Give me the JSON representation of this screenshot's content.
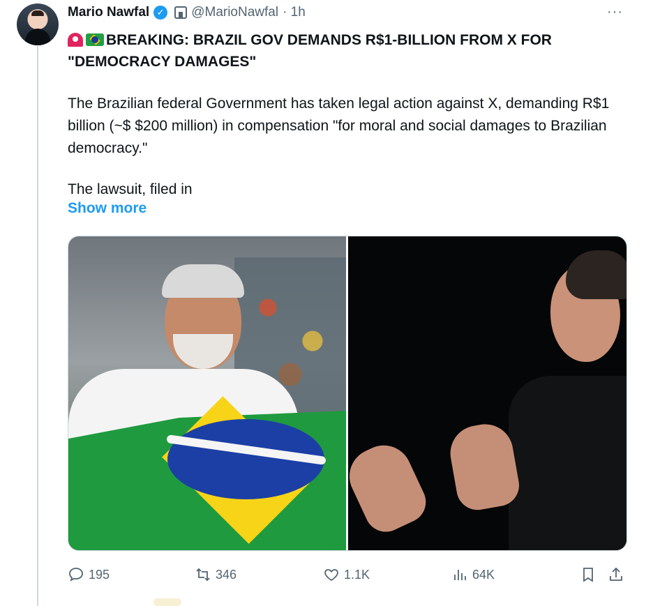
{
  "tweet": {
    "author_name": "Mario Nawfal",
    "author_handle": "@MarioNawfal",
    "time": "· 1h",
    "more_label": "···",
    "headline": "BREAKING: BRAZIL GOV DEMANDS R$1-BILLION FROM X FOR \"DEMOCRACY DAMAGES\"",
    "paragraph1": "The Brazilian federal Government has taken legal action against X, demanding R$1 billion (~$ $200 million) in compensation \"for moral and social damages to Brazilian democracy.\"",
    "paragraph2": "The lawsuit, filed in",
    "show_more": "Show more"
  },
  "actions": {
    "replies": "195",
    "retweets": "346",
    "likes": "1.1K",
    "views": "64K"
  },
  "icons": [
    "siren-emoji",
    "brazil-flag-emoji",
    "verified-icon",
    "affiliate-badge-icon",
    "more-icon",
    "reply-icon",
    "retweet-icon",
    "like-icon",
    "views-icon",
    "bookmark-icon",
    "share-icon"
  ],
  "colors": {
    "accent": "#1d9bf0",
    "muted": "#536471",
    "text": "#0f1419"
  }
}
